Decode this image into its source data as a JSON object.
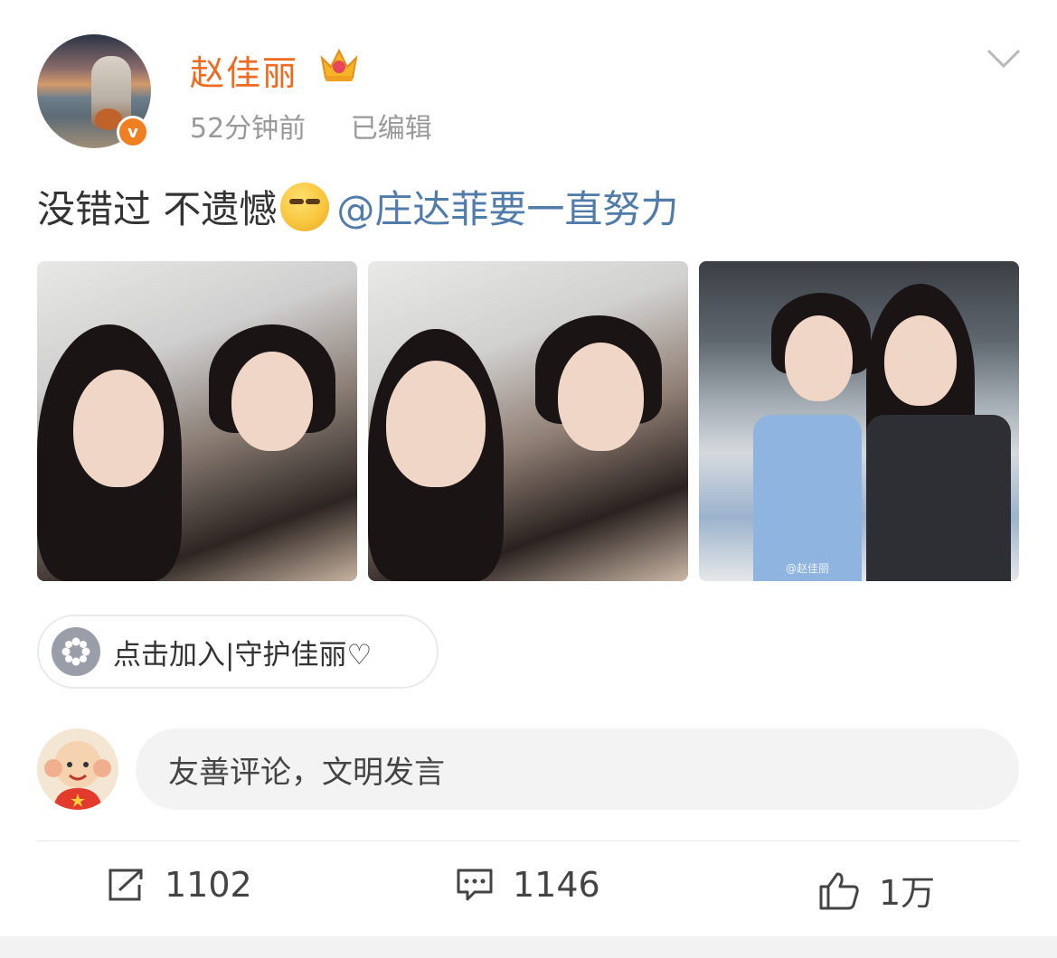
{
  "post": {
    "author": "赵佳丽",
    "time": "52分钟前",
    "edited": "已编辑",
    "text": "没错过 不遗憾",
    "mention": "@庄达菲要一直努力",
    "photo_watermark": "@赵佳丽",
    "group_label": "点击加入|守护佳丽♡"
  },
  "comment": {
    "placeholder": "友善评论，文明发言"
  },
  "actions": {
    "reposts": "1102",
    "comments": "1146",
    "likes": "1万"
  },
  "colors": {
    "username": "#ee6a20",
    "mention": "#517ba8",
    "verified_badge": "#f07f22"
  },
  "icons": [
    "crown-icon",
    "verified-badge-icon",
    "chevron-down-icon",
    "emoji-icon",
    "group-icon",
    "repost-icon",
    "comment-icon",
    "like-icon"
  ]
}
